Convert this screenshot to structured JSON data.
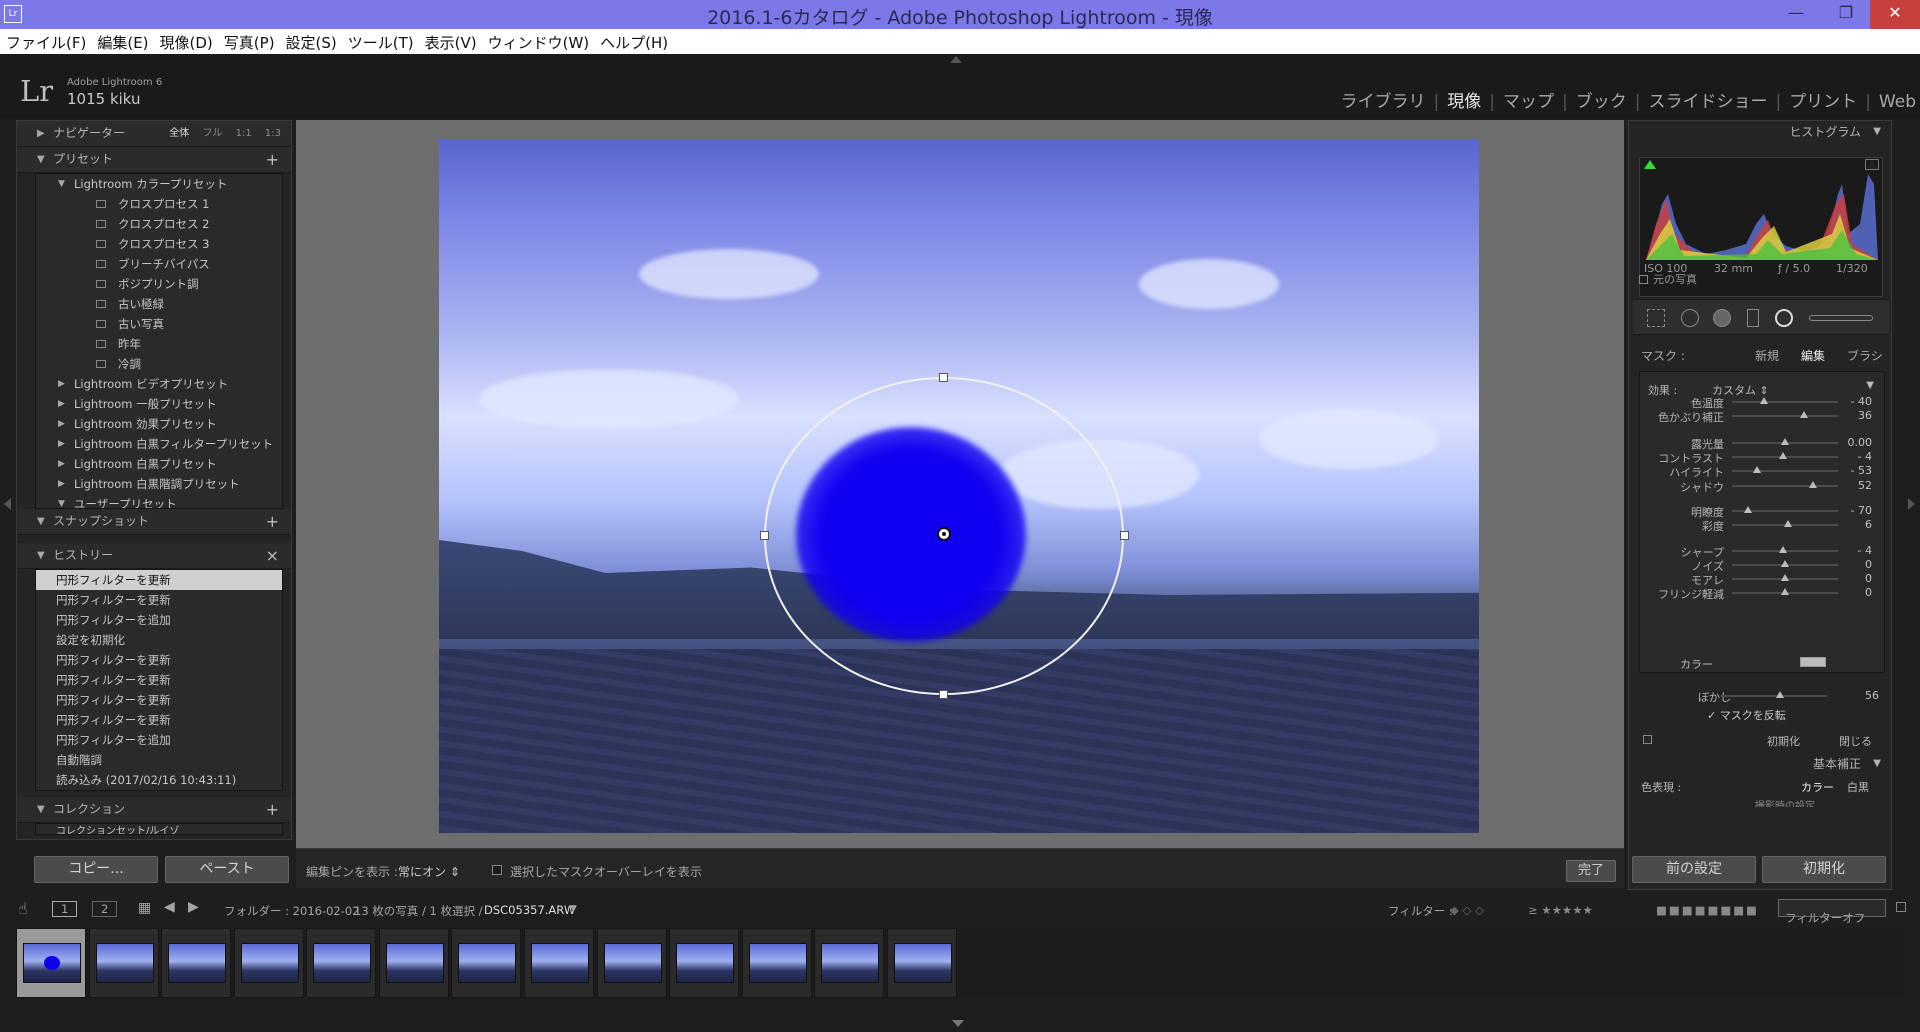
{
  "window": {
    "title": "2016.1-6カタログ - Adobe Photoshop Lightroom - 現像",
    "app_icon": "Lr"
  },
  "menu": [
    "ファイル(F)",
    "編集(E)",
    "現像(D)",
    "写真(P)",
    "設定(S)",
    "ツール(T)",
    "表示(V)",
    "ウィンドウ(W)",
    "ヘルプ(H)"
  ],
  "identity": {
    "logo": "Lr",
    "app_name": "Adobe Lightroom 6",
    "user": "1015 kiku"
  },
  "modules": [
    "ライブラリ",
    "現像",
    "マップ",
    "ブック",
    "スライドショー",
    "プリント",
    "Web"
  ],
  "active_module": "現像",
  "left": {
    "navigator": {
      "label": "ナビゲーター",
      "options": [
        "全体",
        "フル",
        "1:1",
        "1:3"
      ]
    },
    "presets": {
      "label": "プリセット",
      "items": [
        {
          "label": "Lightroom カラープリセット",
          "level": 0,
          "expanded": true
        },
        {
          "label": "クロスプロセス 1",
          "level": 1
        },
        {
          "label": "クロスプロセス 2",
          "level": 1
        },
        {
          "label": "クロスプロセス 3",
          "level": 1
        },
        {
          "label": "ブリーチバイパス",
          "level": 1
        },
        {
          "label": "ポジプリント調",
          "level": 1
        },
        {
          "label": "古い極緑",
          "level": 1
        },
        {
          "label": "古い写真",
          "level": 1
        },
        {
          "label": "昨年",
          "level": 1
        },
        {
          "label": "冷調",
          "level": 1
        },
        {
          "label": "Lightroom ビデオプリセット",
          "level": 0
        },
        {
          "label": "Lightroom 一般プリセット",
          "level": 0
        },
        {
          "label": "Lightroom 効果プリセット",
          "level": 0
        },
        {
          "label": "Lightroom 白黒フィルタープリセット",
          "level": 0
        },
        {
          "label": "Lightroom 白黒プリセット",
          "level": 0
        },
        {
          "label": "Lightroom 白黒階調プリセット",
          "level": 0
        },
        {
          "label": "ユーザープリセット",
          "level": 0,
          "expanded": true
        }
      ]
    },
    "snapshots": {
      "label": "スナップショット"
    },
    "history": {
      "label": "ヒストリー",
      "items": [
        "円形フィルターを更新",
        "円形フィルターを更新",
        "円形フィルターを追加",
        "設定を初期化",
        "円形フィルターを更新",
        "円形フィルターを更新",
        "円形フィルターを更新",
        "円形フィルターを更新",
        "円形フィルターを追加",
        "自動階調",
        "読み込み (2017/02/16 10:43:11)"
      ],
      "selected_index": 0
    },
    "collections": {
      "label": "コレクション",
      "partial_item": "コレクションセット/ルイゾ"
    },
    "copy_button": "コピー...",
    "paste_button": "ペースト"
  },
  "toolbar": {
    "show_pins_label": "編集ピンを表示 :",
    "show_pins_value": "常にオン",
    "overlay_label": "選択したマスクオーバーレイを表示",
    "overlay_checked": false,
    "done_button": "完了"
  },
  "right": {
    "histogram_label": "ヒストグラム",
    "exif": {
      "iso": "ISO 100",
      "focal": "32 mm",
      "aperture": "ƒ / 5.0",
      "shutter": "1/320"
    },
    "original_photo_label": "元の写真",
    "mask": {
      "label": "マスク :",
      "new": "新規",
      "edit": "編集",
      "brush": "ブラシ",
      "active": "編集"
    },
    "effect": {
      "label": "効果 :",
      "value": "カスタム"
    },
    "sliders": [
      {
        "name": "色温度",
        "value": "- 40",
        "pos": 0.3
      },
      {
        "name": "色かぶり補正",
        "value": "36",
        "pos": 0.68
      },
      {
        "name": "露光量",
        "value": "0.00",
        "pos": 0.5
      },
      {
        "name": "コントラスト",
        "value": "- 4",
        "pos": 0.48
      },
      {
        "name": "ハイライト",
        "value": "- 53",
        "pos": 0.24
      },
      {
        "name": "シャドウ",
        "value": "52",
        "pos": 0.76
      },
      {
        "name": "明瞭度",
        "value": "- 70",
        "pos": 0.15
      },
      {
        "name": "彩度",
        "value": "6",
        "pos": 0.53
      },
      {
        "name": "シャープ",
        "value": "- 4",
        "pos": 0.48
      },
      {
        "name": "ノイズ",
        "value": "0",
        "pos": 0.5
      },
      {
        "name": "モアレ",
        "value": "0",
        "pos": 0.5
      },
      {
        "name": "フリンジ軽減",
        "value": "0",
        "pos": 0.5
      }
    ],
    "color_label": "カラー",
    "feather": {
      "name": "ぼかし",
      "value": "56",
      "pos": 0.56
    },
    "invert_mask": {
      "label": "マスクを反転",
      "checked": true
    },
    "reset_label": "初期化",
    "close_label": "閉じる",
    "basic_label": "基本補正",
    "treatment": {
      "label": "色表現 :",
      "color": "カラー",
      "bw": "白黒"
    },
    "wb_partial": "撮影時の設定",
    "prev_button": "前の設定",
    "reset_button": "初期化"
  },
  "filmstrip": {
    "page1": "1",
    "page2": "2",
    "path": "フォルダー : 2016-02-02",
    "count": "13 枚の写真 / 1 枚選択 /",
    "filename": "DSC05357.ARW",
    "filter_label": "フィルター :",
    "filter_value": "フィルターオフ",
    "thumb_count": 13,
    "selected": 0
  },
  "colors": {
    "titlebar": "#7b78e8",
    "mask_overlay": "#1000f0",
    "panel": "#242424",
    "close": "#c7403b"
  }
}
